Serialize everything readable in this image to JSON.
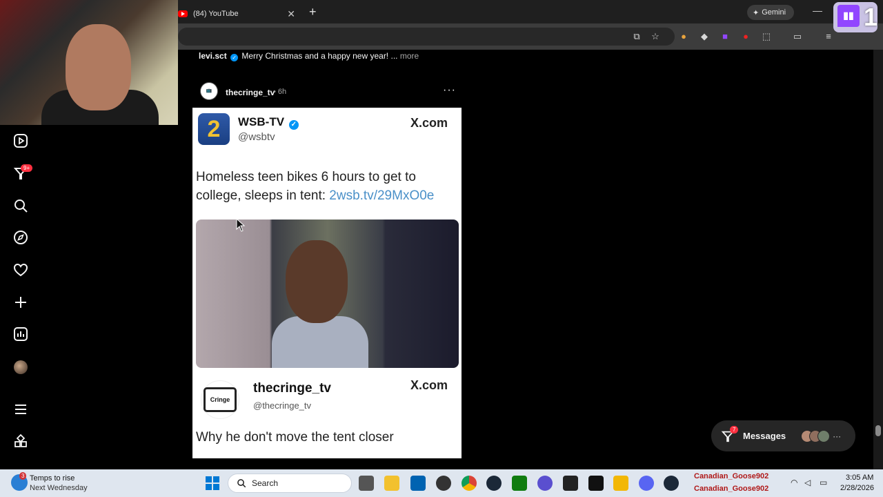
{
  "browser": {
    "tabs": [
      {
        "label": ""
      },
      {
        "label": "(84) YouTube",
        "close": "✕"
      }
    ],
    "new_tab": "+",
    "gemini_label": "Gemini",
    "minimize": "—"
  },
  "stream_overlay": {
    "twitch_glyph": "▮▮",
    "number": "1"
  },
  "sidebar": {
    "icons": [
      "reels-icon",
      "notifications-icon",
      "search-icon",
      "explore-icon",
      "likes-icon",
      "create-icon",
      "dashboard-icon",
      "profile-avatar",
      "menu-icon",
      "more-icon"
    ],
    "notifications_badge": "9+"
  },
  "feed": {
    "previous_post": {
      "username": "levi.sct",
      "caption": "Merry Christmas and a happy new year! ...",
      "more": "more"
    },
    "post": {
      "username": "thecringe_tv",
      "time": "• 6h",
      "menu": "···",
      "tweet": {
        "logo_digit": "2",
        "name": "WSB-TV",
        "handle": "@wsbtv",
        "source": "X.com",
        "text": "Homeless teen bikes 6 hours to get to college, sleeps in tent: ",
        "link": "2wsb.tv/29MxO0e"
      },
      "reply": {
        "avatar_label": "Cringe",
        "name": "thecringe_tv",
        "handle": "@thecringe_tv",
        "source": "X.com",
        "text": "Why he don't move the tent closer"
      }
    }
  },
  "messages": {
    "label": "Messages",
    "badge": "7",
    "overflow": "···"
  },
  "taskbar": {
    "weather_badge": "3",
    "weather_title": "Temps to rise",
    "weather_subtitle": "Next Wednesday",
    "search_placeholder": "Search",
    "tray_user_1": "Canadian_Goose902",
    "tray_user_2": "Canadian_Goose902",
    "time": "3:05 AM",
    "date": "2/28/2026"
  },
  "colors": {
    "accent_blue": "#0095f6",
    "badge_red": "#ff3040",
    "twitch_purple": "#9146ff",
    "link_blue": "#4a90c8"
  }
}
